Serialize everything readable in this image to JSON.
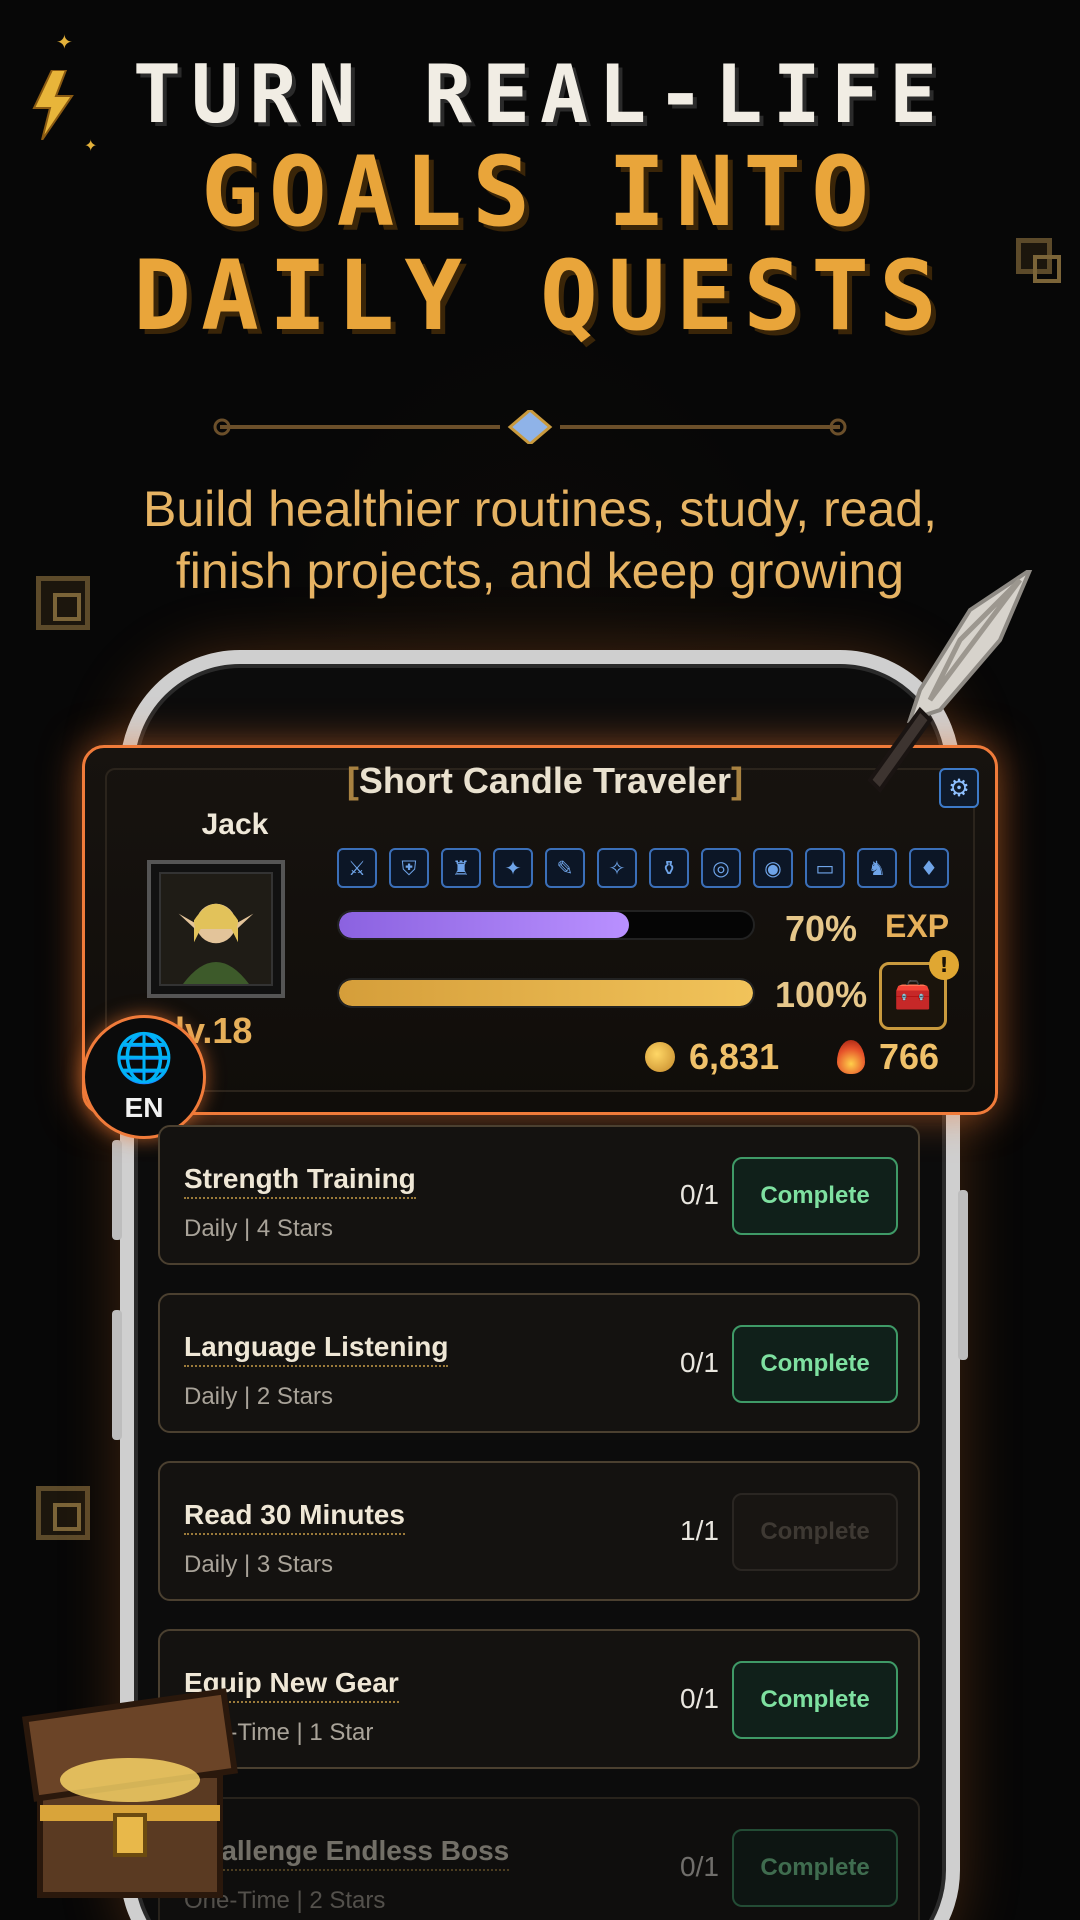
{
  "headline": {
    "line1": "TURN REAL-LIFE",
    "line2": "GOALS INTO",
    "line3": "DAILY QUESTS"
  },
  "subtitle": {
    "line1": "Build healthier routines, study, read,",
    "line2": "finish projects, and keep growing"
  },
  "profile": {
    "title": "Short Candle Traveler",
    "name": "Jack",
    "level": "lv.18",
    "exp_percent_label": "70%",
    "exp_label": "EXP",
    "exp_progress": 0.7,
    "gold_percent_label": "100%",
    "gold_progress": 1.0,
    "coins": "6,831",
    "flames": "766",
    "alert_badge": "!",
    "equipment_slots": [
      "⚔",
      "⛨",
      "♜",
      "✦",
      "✎",
      "✧",
      "⚱",
      "◎",
      "◉",
      "▭",
      "♞",
      "♦"
    ]
  },
  "language": {
    "code": "EN"
  },
  "quests": [
    {
      "title": "Strength Training",
      "meta": "Daily | 4 Stars",
      "count": "0/1",
      "button": "Complete",
      "enabled": true
    },
    {
      "title": "Language Listening",
      "meta": "Daily | 2 Stars",
      "count": "0/1",
      "button": "Complete",
      "enabled": true
    },
    {
      "title": "Read 30 Minutes",
      "meta": "Daily | 3 Stars",
      "count": "1/1",
      "button": "Complete",
      "enabled": false
    },
    {
      "title": "Equip New Gear",
      "meta": "One-Time | 1 Star",
      "count": "0/1",
      "button": "Complete",
      "enabled": true
    },
    {
      "title": "Challenge Endless Boss",
      "meta": "One-Time | 2 Stars",
      "count": "0/1",
      "button": "Complete",
      "enabled": true
    }
  ],
  "colors": {
    "accent_orange": "#f07b3a",
    "gold_text": "#e9a53a",
    "complete_green": "#7ee0a0",
    "exp_purple": "#b990ff"
  }
}
